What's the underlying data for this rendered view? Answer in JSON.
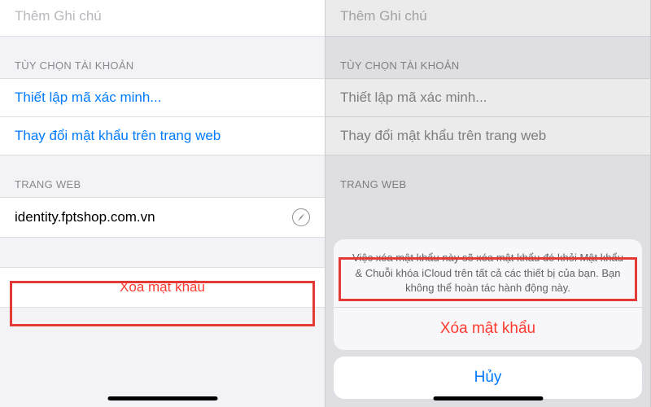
{
  "left": {
    "notes_placeholder": "Thêm Ghi chú",
    "account_header": "TÙY CHỌN TÀI KHOẢN",
    "setup_code": "Thiết lập mã xác minh...",
    "change_pw": "Thay đổi mật khẩu trên trang web",
    "website_header": "TRANG WEB",
    "website_value": "identity.fptshop.com.vn",
    "delete_label": "Xóa mật khẩu"
  },
  "right": {
    "notes_placeholder": "Thêm Ghi chú",
    "account_header": "TÙY CHỌN TÀI KHOẢN",
    "setup_code": "Thiết lập mã xác minh...",
    "change_pw": "Thay đổi mật khẩu trên trang web",
    "website_header": "TRANG WEB",
    "sheet_message": "Việc xóa mật khẩu này sẽ xóa mật khẩu đó khỏi Mật khẩu & Chuỗi khóa iCloud trên tất cả các thiết bị của bạn. Bạn không thể hoàn tác hành động này.",
    "sheet_delete": "Xóa mật khẩu",
    "sheet_cancel": "Hủy"
  }
}
